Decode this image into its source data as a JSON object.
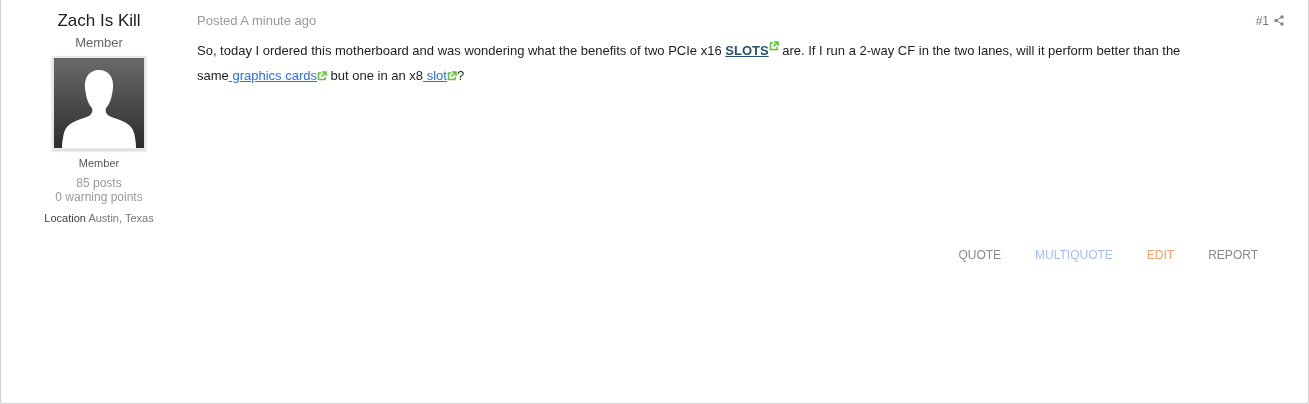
{
  "author": {
    "name": "Zach Is Kill",
    "title": "Member",
    "rank": "Member",
    "posts": "85 posts",
    "warning_points": "0 warning points",
    "location_label": "Location",
    "location": "Austin, Texas"
  },
  "post": {
    "posted": "Posted A minute ago",
    "number": "#1",
    "body": [
      {
        "kind": "text",
        "text": "So, today I ordered this motherboard and was wondering what the benefits of two PCIe x16 "
      },
      {
        "kind": "link",
        "text": "SLOTS",
        "strong": true
      },
      {
        "kind": "text",
        "text": "  are. If I run a 2-way CF in the two lanes, will it perform better than the same"
      },
      {
        "kind": "link",
        "text": " graphics cards",
        "strong": false
      },
      {
        "kind": "text",
        "text": " but one in an x8"
      },
      {
        "kind": "link",
        "text": " slot",
        "strong": false
      },
      {
        "kind": "text",
        "text": "?"
      }
    ]
  },
  "actions": [
    {
      "label": "QUOTE",
      "color": "#8a8a8a"
    },
    {
      "label": "MULTIQUOTE",
      "color": "#a4bdf5"
    },
    {
      "label": "EDIT",
      "color": "#f0a070"
    },
    {
      "label": "REPORT",
      "color": "#8a8a8a"
    }
  ]
}
